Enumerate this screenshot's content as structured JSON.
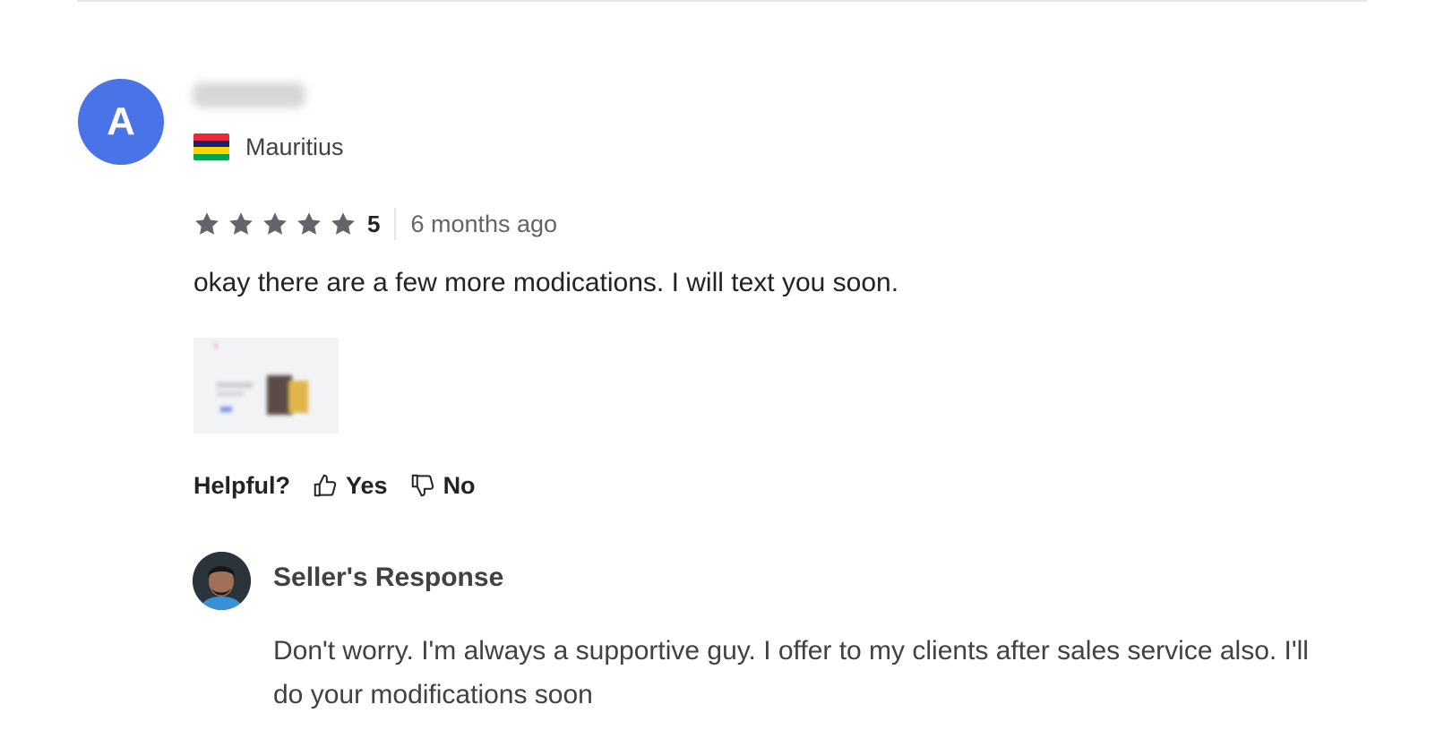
{
  "review": {
    "avatar_letter": "A",
    "avatar_color": "#4a73e8",
    "username": "",
    "country": "Mauritius",
    "flag_colors": [
      "#ea2839",
      "#1a206d",
      "#ffd500",
      "#00a551"
    ],
    "rating": {
      "stars": 5,
      "score": "5",
      "star_color": "#62646a"
    },
    "time_ago": "6 months ago",
    "text": "okay there are a few more modications. I will text you soon.",
    "helpful": {
      "label": "Helpful?",
      "yes_label": "Yes",
      "no_label": "No"
    }
  },
  "seller_response": {
    "title": "Seller's Response",
    "text": "Don't worry. I'm always a supportive guy. I offer to my clients after sales service also. I'll do your modifications soon"
  }
}
